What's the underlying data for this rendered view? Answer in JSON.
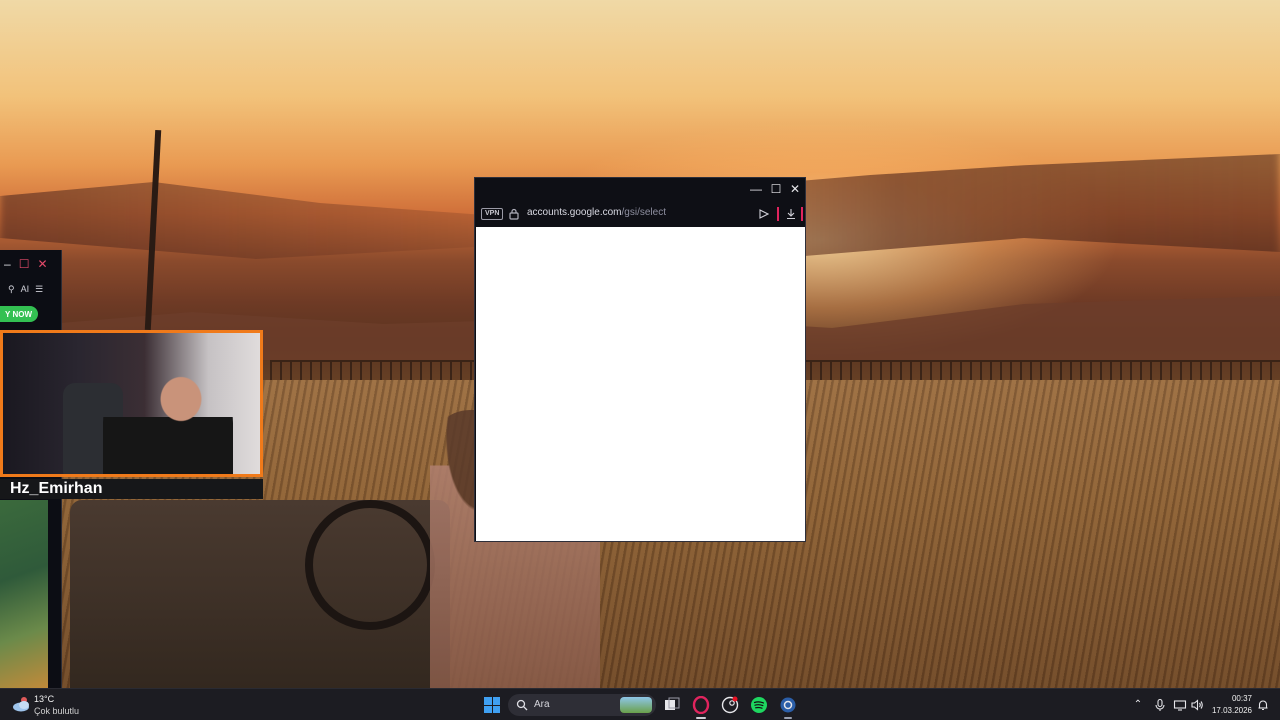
{
  "popup_window": {
    "vpn_label": "VPN",
    "url_domain": "accounts.google.com",
    "url_path": "/gsi/select",
    "minimize_glyph": "—",
    "maximize_glyph": "☐",
    "close_glyph": "✕"
  },
  "left_window": {
    "ai_label": "AI",
    "promo_button_label": "Y NOW"
  },
  "webcam": {
    "streamer_name": "Hz_Emirhan"
  },
  "taskbar": {
    "weather_temp": "13°C",
    "weather_desc": "Çok bulutlu",
    "search_placeholder": "Ara",
    "clock_time": "00:37",
    "clock_date": "17.03.2026"
  },
  "colors": {
    "accent_pink": "#e0245e",
    "webcam_border": "#f07a1a",
    "taskbar_bg": "#1c1c22"
  }
}
